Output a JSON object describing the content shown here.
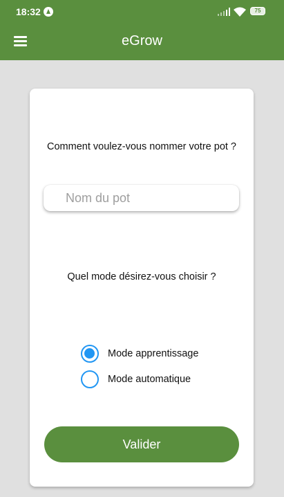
{
  "status_bar": {
    "time": "18:32",
    "battery": "75",
    "app_icon": "app-notification-icon"
  },
  "app_bar": {
    "menu_icon": "menu-icon",
    "title": "eGrow"
  },
  "form": {
    "name_question": "Comment voulez-vous nommer votre pot ?",
    "name_placeholder": "Nom du pot",
    "name_value": "",
    "mode_question": "Quel mode désirez-vous choisir ?",
    "modes": [
      {
        "label": "Mode apprentissage",
        "selected": true
      },
      {
        "label": "Mode automatique",
        "selected": false
      }
    ],
    "submit_label": "Valider"
  },
  "colors": {
    "primary": "#5a8f3e",
    "accent": "#2196f3",
    "background": "#e0e0e0"
  }
}
